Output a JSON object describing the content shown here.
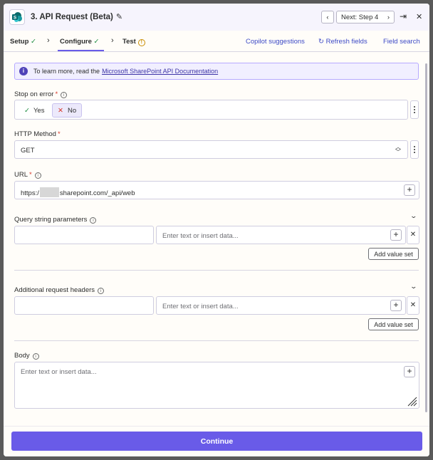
{
  "header": {
    "title": "3. API Request (Beta)",
    "next_label": "Next: Step 4",
    "app_logo_letter": "S"
  },
  "tabs": {
    "setup": "Setup",
    "configure": "Configure",
    "test": "Test",
    "copilot": "Copilot suggestions",
    "refresh": "Refresh fields",
    "field_search": "Field search"
  },
  "banner": {
    "text": "To learn more, read the",
    "link": "Microsoft SharePoint API Documentation"
  },
  "stop_on_error": {
    "label": "Stop on error",
    "yes": "Yes",
    "no": "No",
    "selected": "No"
  },
  "http_method": {
    "label": "HTTP Method",
    "value": "GET"
  },
  "url": {
    "label": "URL",
    "prefix": "https:/",
    "suffix": "sharepoint.com/_api/web"
  },
  "query_params": {
    "label": "Query string parameters",
    "value_placeholder": "Enter text or insert data...",
    "add_label": "Add value set"
  },
  "headers": {
    "label": "Additional request headers",
    "value_placeholder": "Enter text or insert data...",
    "add_label": "Add value set"
  },
  "body": {
    "label": "Body",
    "placeholder": "Enter text or insert data..."
  },
  "footer": {
    "continue_label": "Continue"
  },
  "colors": {
    "accent": "#695be8",
    "banner_bg": "#f1efff",
    "required": "#d73a2c",
    "success": "#1c8c3f"
  }
}
